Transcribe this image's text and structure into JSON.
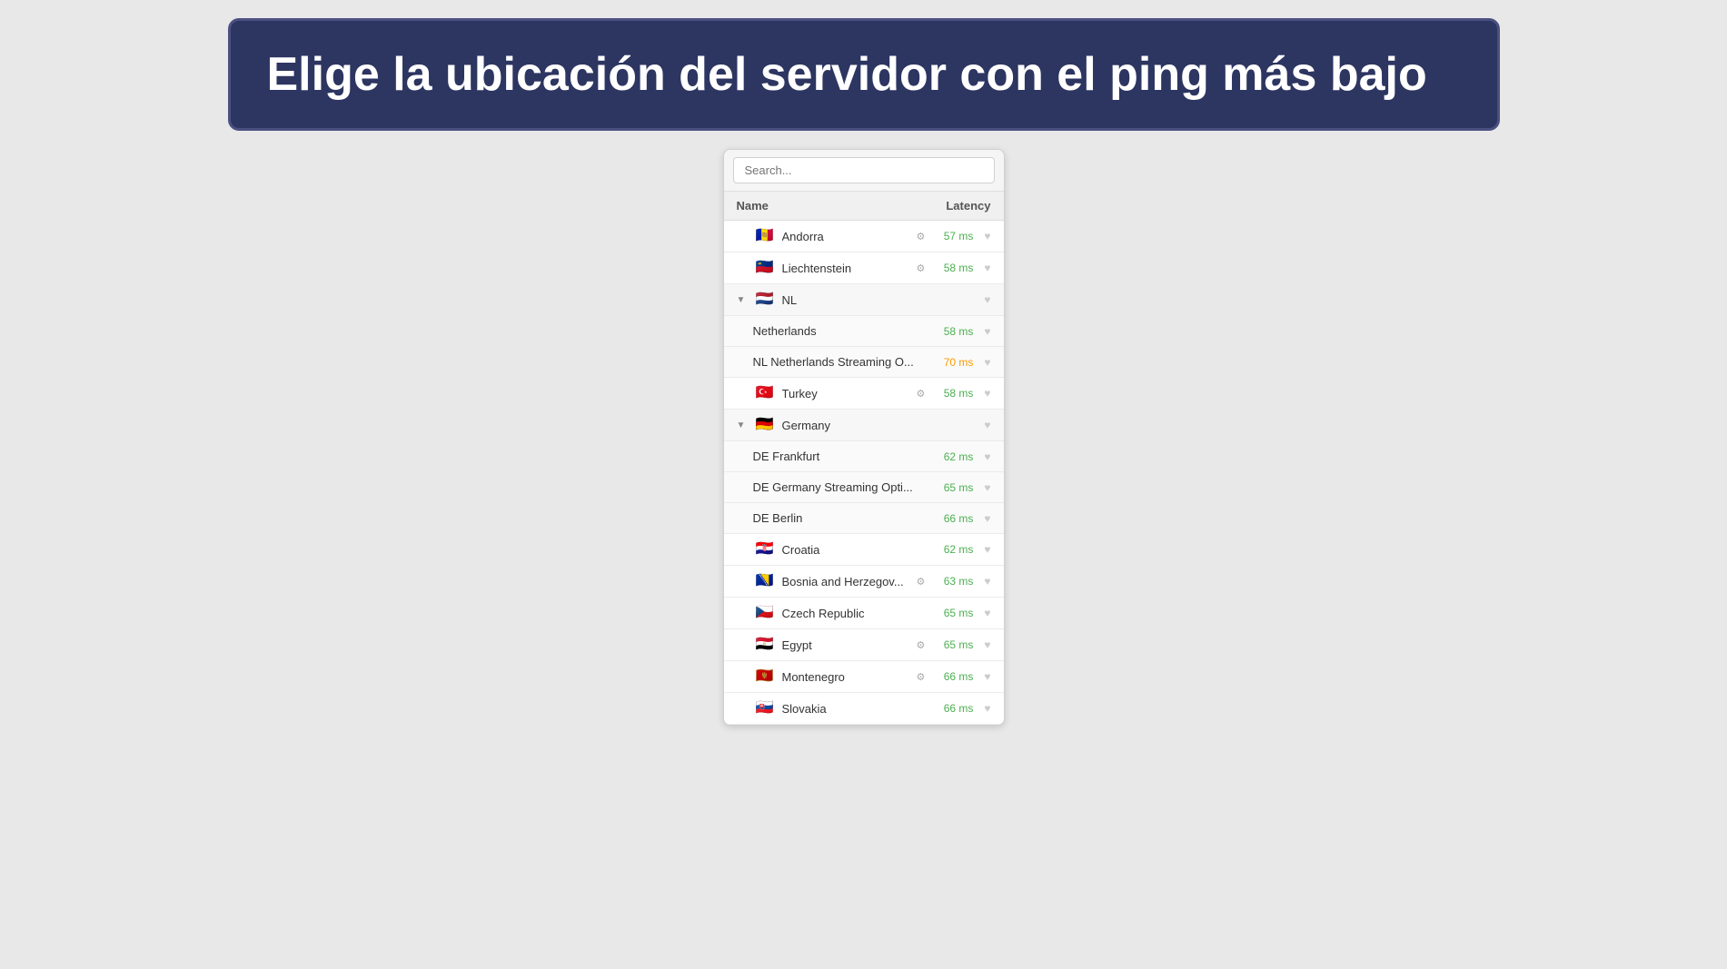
{
  "banner": {
    "title": "Elige la ubicación del servidor con el ping más bajo"
  },
  "search": {
    "placeholder": "Search..."
  },
  "table_header": {
    "name_col": "Name",
    "latency_col": "Latency"
  },
  "server_list": [
    {
      "id": "andorra",
      "name": "Andorra",
      "flag": "🇦🇩",
      "latency": "57 ms",
      "latency_class": "good",
      "has_gear": true,
      "is_parent": false,
      "is_child": false,
      "expanded": false
    },
    {
      "id": "liechtenstein",
      "name": "Liechtenstein",
      "flag": "🇱🇮",
      "latency": "58 ms",
      "latency_class": "good",
      "has_gear": true,
      "is_parent": false,
      "is_child": false,
      "expanded": false
    },
    {
      "id": "nl-parent",
      "name": "NL",
      "flag": "🇳🇱",
      "latency": "",
      "latency_class": "",
      "has_gear": false,
      "is_parent": true,
      "is_child": false,
      "expanded": true
    },
    {
      "id": "netherlands",
      "name": "Netherlands",
      "flag": "",
      "latency": "58 ms",
      "latency_class": "good",
      "has_gear": false,
      "is_parent": false,
      "is_child": true,
      "expanded": false
    },
    {
      "id": "nl-streaming",
      "name": "NL Netherlands Streaming O...",
      "flag": "",
      "latency": "70 ms",
      "latency_class": "medium",
      "has_gear": false,
      "is_parent": false,
      "is_child": true,
      "expanded": false
    },
    {
      "id": "turkey",
      "name": "Turkey",
      "flag": "🇹🇷",
      "latency": "58 ms",
      "latency_class": "good",
      "has_gear": true,
      "is_parent": false,
      "is_child": false,
      "expanded": false
    },
    {
      "id": "germany-parent",
      "name": "Germany",
      "flag": "🇩🇪",
      "latency": "",
      "latency_class": "",
      "has_gear": false,
      "is_parent": true,
      "is_child": false,
      "expanded": true
    },
    {
      "id": "de-frankfurt",
      "name": "DE Frankfurt",
      "flag": "",
      "latency": "62 ms",
      "latency_class": "good",
      "has_gear": false,
      "is_parent": false,
      "is_child": true,
      "expanded": false
    },
    {
      "id": "de-streaming",
      "name": "DE Germany Streaming Opti...",
      "flag": "",
      "latency": "65 ms",
      "latency_class": "good",
      "has_gear": false,
      "is_parent": false,
      "is_child": true,
      "expanded": false
    },
    {
      "id": "de-berlin",
      "name": "DE Berlin",
      "flag": "",
      "latency": "66 ms",
      "latency_class": "good",
      "has_gear": false,
      "is_parent": false,
      "is_child": true,
      "expanded": false
    },
    {
      "id": "croatia",
      "name": "Croatia",
      "flag": "🇭🇷",
      "latency": "62 ms",
      "latency_class": "good",
      "has_gear": false,
      "is_parent": false,
      "is_child": false,
      "expanded": false
    },
    {
      "id": "bosnia",
      "name": "Bosnia and Herzegov...",
      "flag": "🇧🇦",
      "latency": "63 ms",
      "latency_class": "good",
      "has_gear": true,
      "is_parent": false,
      "is_child": false,
      "expanded": false
    },
    {
      "id": "czech-republic",
      "name": "Czech Republic",
      "flag": "🇨🇿",
      "latency": "65 ms",
      "latency_class": "good",
      "has_gear": false,
      "is_parent": false,
      "is_child": false,
      "expanded": false
    },
    {
      "id": "egypt",
      "name": "Egypt",
      "flag": "🇪🇬",
      "latency": "65 ms",
      "latency_class": "good",
      "has_gear": true,
      "is_parent": false,
      "is_child": false,
      "expanded": false
    },
    {
      "id": "montenegro",
      "name": "Montenegro",
      "flag": "🇲🇪",
      "latency": "66 ms",
      "latency_class": "good",
      "has_gear": true,
      "is_parent": false,
      "is_child": false,
      "expanded": false
    },
    {
      "id": "slovakia",
      "name": "Slovakia",
      "flag": "🇸🇰",
      "latency": "66 ms",
      "latency_class": "good",
      "has_gear": false,
      "is_parent": false,
      "is_child": false,
      "expanded": false
    }
  ]
}
